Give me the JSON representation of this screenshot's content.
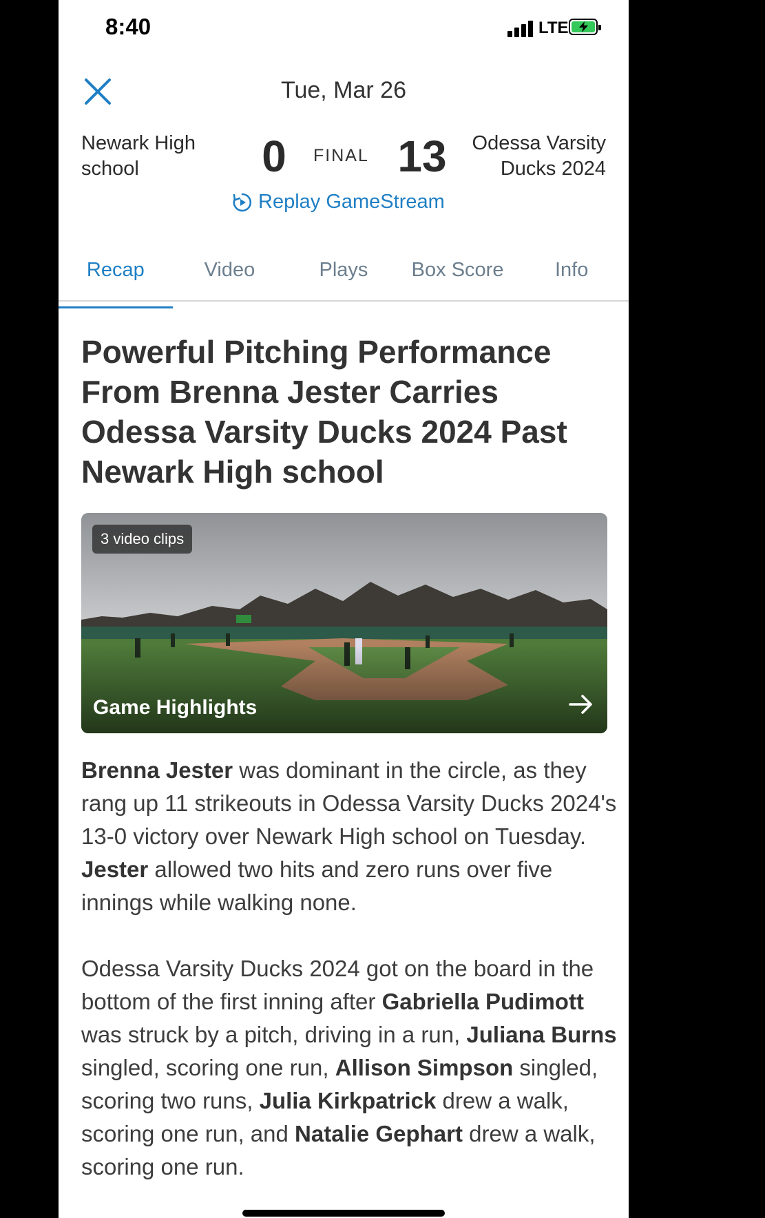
{
  "status_bar": {
    "time": "8:40",
    "network": "LTE"
  },
  "header": {
    "date": "Tue, Mar 26",
    "close_icon": "close-icon"
  },
  "game": {
    "home_team": "Newark High school",
    "home_score": "0",
    "status": "FINAL",
    "away_score": "13",
    "away_team_line1": "Odessa Varsity",
    "away_team_line2": "Ducks 2024",
    "replay_label": "Replay GameStream"
  },
  "tabs": [
    {
      "label": "Recap",
      "active": true
    },
    {
      "label": "Video",
      "active": false
    },
    {
      "label": "Plays",
      "active": false
    },
    {
      "label": "Box Score",
      "active": false
    },
    {
      "label": "Info",
      "active": false
    }
  ],
  "article": {
    "headline": "Powerful Pitching Performance From Brenna Jester Carries Odessa Varsity Ducks 2024 Past Newark High school",
    "video_card": {
      "clips_badge": "3 video clips",
      "label": "Game Highlights"
    },
    "p1": {
      "s1": "Brenna Jester",
      "s2": " was dominant in the circle, as they rang up 11 strikeouts in Odessa Varsity Ducks 2024's 13-0 victory over Newark High school on Tuesday. ",
      "s3": "Jester",
      "s4": " allowed two hits and zero runs over five innings while walking none."
    },
    "p2": {
      "s1": "Odessa Varsity Ducks 2024 got on the board in the bottom of the first inning after ",
      "s2": "Gabriella Pudimott",
      "s3": " was struck by a pitch, driving in a run, ",
      "s4": "Juliana Burns",
      "s5": " singled, scoring one run, ",
      "s6": "Allison Simpson",
      "s7": " singled, scoring two runs, ",
      "s8": "Julia Kirkpatrick",
      "s9": " drew a walk, scoring one run, and ",
      "s10": "Natalie Gephart",
      "s11": " drew a walk, scoring one run."
    }
  },
  "colors": {
    "accent": "#1f7fc4",
    "text": "#333333",
    "battery": "#34c759"
  }
}
